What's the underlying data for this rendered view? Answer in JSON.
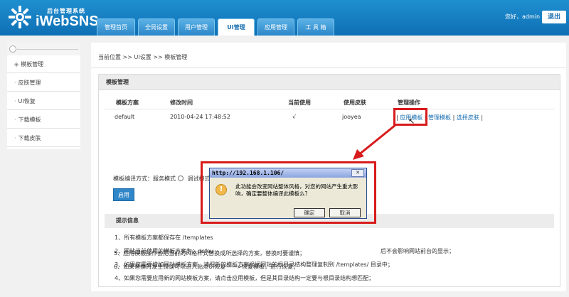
{
  "header": {
    "subtitle": "后台管理系统",
    "brand": "iWebSNS",
    "greeting": "您好，admin",
    "logout_label": "退出",
    "tabs": [
      {
        "label": "管理首页"
      },
      {
        "label": "全局设置"
      },
      {
        "label": "用户管理"
      },
      {
        "label": "UI管理"
      },
      {
        "label": "应用管理"
      },
      {
        "label": "工 具 箱"
      }
    ],
    "active_tab": "UI管理"
  },
  "sidebar": {
    "items": [
      {
        "label": "模板管理"
      },
      {
        "label": "皮肤管理"
      },
      {
        "label": "UI恢复"
      },
      {
        "label": "下载模板"
      },
      {
        "label": "下载皮肤"
      }
    ]
  },
  "main": {
    "breadcrumb": "当前位置 >> UI设置 >> 模板管理",
    "panel_title": "模板管理",
    "table": {
      "headers": [
        "模板方案",
        "修改时间",
        "当前使用",
        "使用皮肤",
        "管理操作"
      ],
      "rows": [
        {
          "scheme": "default",
          "time": "2010-04-24 17:48:52",
          "current": "√",
          "skin": "jooyea",
          "ops": [
            "应用模板",
            "管理模板",
            "选择皮肤"
          ]
        }
      ]
    },
    "compile_mode_label": "模板编译方式：",
    "mode_service": "服务模式",
    "mode_debug": "调试模式",
    "selected_mode": "调试模式",
    "apply_label": "启用",
    "tips_title": "提示信息",
    "tips": [
      "1、所有模板方案都保存在 /templates",
      "2、网站当前使用的模板方案为：defau",
      "3、如果您需要增加网站模板方案，请把新的模板方案根据网站的根目录结构整理复制到 /templates/ 目录中；",
      "4、如果您需要应用新的网站模板方案，请点击应用模板，但是其目录结构一定要与根目录结构想匹配；",
      "5、应用模板操作会把当前的风格样式替换成所选择的方案，替换时要谨慎；",
      "6、如果替换时发生错误可以进入站点UI恢复——>恢复模板，进行恢复；"
    ],
    "tip2_tail": "后不会影响网站前台的显示；"
  },
  "dialog": {
    "title": "http://192.168.1.106/",
    "message": "此功能会改变网站整体风格，对您的网站产生重大影响，确定要整体编译此模板么？",
    "ok_label": "确定",
    "cancel_label": "取消"
  },
  "colors": {
    "header_blue": "#1a7cc2",
    "annotation_red": "#d81b1b",
    "link_blue": "#1a6fb0"
  }
}
